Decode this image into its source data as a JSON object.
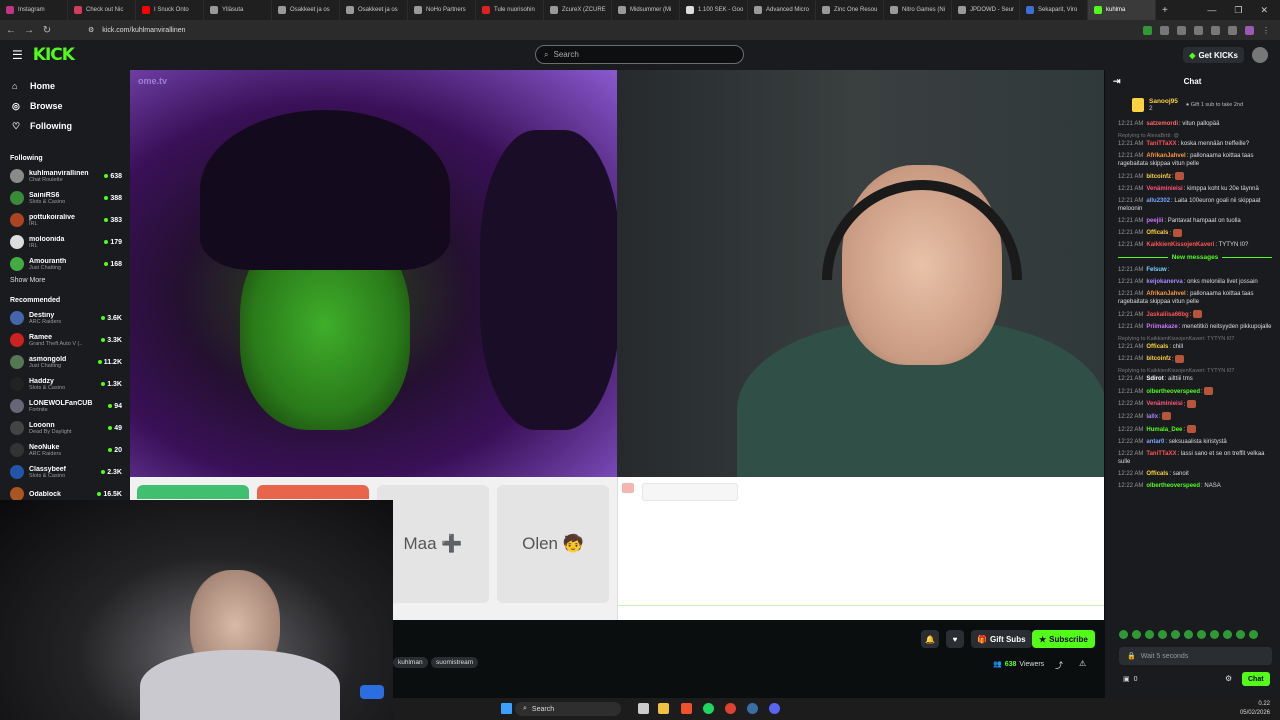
{
  "browser": {
    "tabs": [
      {
        "label": "Instagram",
        "color": "#c13584"
      },
      {
        "label": "Check out Nic",
        "color": "#d23c5a"
      },
      {
        "label": "I Snuck Onto",
        "color": "#ff0000"
      },
      {
        "label": "Ylläsuta",
        "color": "#9a9a9a"
      },
      {
        "label": "Osakkeet ja os",
        "color": "#9a9a9a"
      },
      {
        "label": "Osakkeet ja os",
        "color": "#9a9a9a"
      },
      {
        "label": "NoHo Partners",
        "color": "#9a9a9a"
      },
      {
        "label": "Tule nuorisohin",
        "color": "#e02020"
      },
      {
        "label": "ZcureX (ZCURE",
        "color": "#9a9a9a"
      },
      {
        "label": "Midsummer (Mi",
        "color": "#9a9a9a"
      },
      {
        "label": "1.100 SEK - Goo",
        "color": "#dddddd"
      },
      {
        "label": "Advanced Micro",
        "color": "#9a9a9a"
      },
      {
        "label": "Zinc One Resou",
        "color": "#9a9a9a"
      },
      {
        "label": "Nitro Games (Ni",
        "color": "#9a9a9a"
      },
      {
        "label": "JPDOWD - Seur",
        "color": "#9a9a9a"
      },
      {
        "label": "Sekaparit, Viro",
        "color": "#3b6fd4"
      },
      {
        "label": "kuhlma",
        "color": "#53fc18",
        "active": true
      }
    ],
    "new_tab": "+",
    "url": "kick.com/kuhlmanvirallinen"
  },
  "header": {
    "logo": "KICK",
    "search_placeholder": "Search",
    "get_kicks": "Get KICKs"
  },
  "sidebar": {
    "nav": [
      {
        "label": "Home",
        "icon": "home-icon",
        "glyph": "⌂"
      },
      {
        "label": "Browse",
        "icon": "browse-icon",
        "glyph": "◎"
      },
      {
        "label": "Following",
        "icon": "heart-icon",
        "glyph": "♡"
      }
    ],
    "following_title": "Following",
    "following": [
      {
        "name": "kuhlmanvirallinen",
        "category": "Chat Roulette",
        "viewers": "638",
        "color": "#8a8a8a"
      },
      {
        "name": "SainiRS6",
        "category": "Slots & Casino",
        "viewers": "388",
        "color": "#3a8a3a"
      },
      {
        "name": "pottukoiralive",
        "category": "IRL",
        "viewers": "383",
        "color": "#aa4422"
      },
      {
        "name": "moloonida",
        "category": "IRL",
        "viewers": "179",
        "color": "#ddd"
      },
      {
        "name": "Amouranth",
        "category": "Just Chatting",
        "viewers": "168",
        "color": "#44aa44"
      }
    ],
    "show_more": "Show More",
    "recommended_title": "Recommended",
    "recommended": [
      {
        "name": "Destiny",
        "category": "ARC Raiders",
        "viewers": "3.6K",
        "color": "#4466aa"
      },
      {
        "name": "Ramee",
        "category": "Grand Theft Auto V (..",
        "viewers": "3.3K",
        "color": "#cc2222"
      },
      {
        "name": "asmongold",
        "category": "Just Chatting",
        "viewers": "11.2K",
        "color": "#557755"
      },
      {
        "name": "Haddzy",
        "category": "Slots & Casino",
        "viewers": "1.3K",
        "color": "#222"
      },
      {
        "name": "LONEWOLFanCUB",
        "category": "Fortnite",
        "viewers": "94",
        "color": "#667"
      },
      {
        "name": "Looonn",
        "category": "Dead By Daylight",
        "viewers": "49",
        "color": "#444"
      },
      {
        "name": "NeoNuke",
        "category": "ARC Raiders",
        "viewers": "20",
        "color": "#333"
      },
      {
        "name": "Classybeef",
        "category": "Slots & Casino",
        "viewers": "2.3K",
        "color": "#2255aa"
      },
      {
        "name": "Odablock",
        "category": "",
        "viewers": "16.5K",
        "color": "#aa5522"
      }
    ]
  },
  "stream": {
    "ome_logo": "ome.tv",
    "cards": [
      "Maa ➕",
      "Olen 🧒"
    ],
    "gift_subs": "Gift Subs",
    "subscribe": "Subscribe",
    "viewers": "638",
    "viewers_label": "Viewers",
    "tags": [
      "kuhlman",
      "suomistream"
    ]
  },
  "chat": {
    "title": "Chat",
    "pinned_user": "Sanooj95",
    "pinned_text": "Gift 1 sub to take 2nd",
    "pinned_count": "2",
    "messages_before": [
      {
        "time": "12:21 AM",
        "user": "satzemordi",
        "color": "#ff6666",
        "text": "vitun pallopää"
      },
      {
        "time": "12:21 AM",
        "reply": "Replying to AlexaBrtti: @",
        "user": "TaniTTaXX",
        "color": "#ff5555",
        "text": "koska mennään treffeille?"
      },
      {
        "time": "12:21 AM",
        "user": "AfrikanJahvel",
        "color": "#ff9933",
        "text": "pallonaama koittaa taas ragebaitata skippaa vitun pelle"
      },
      {
        "time": "12:21 AM",
        "user": "bitcoinfz",
        "color": "#ffd23f",
        "text": "",
        "emote": true
      },
      {
        "time": "12:21 AM",
        "user": "Venäminieisi",
        "color": "#ff5577",
        "text": "kimppa koht ku 20e täynnä"
      },
      {
        "time": "12:21 AM",
        "user": "allu2302",
        "color": "#7aa5ff",
        "text": "Laita 100euron goali nii skippaat meloonin"
      },
      {
        "time": "12:21 AM",
        "user": "peejiii",
        "color": "#cc77ff",
        "text": "Pantavat hampaat on tuolla"
      },
      {
        "time": "12:21 AM",
        "user": "Officals",
        "color": "#ffd23f",
        "text": "",
        "emote": true
      },
      {
        "time": "12:21 AM",
        "user": "KaikkienKissojenKaveri",
        "color": "#ff5555",
        "text": "TYTYN I0?"
      }
    ],
    "new_messages": "New messages",
    "messages_after": [
      {
        "time": "12:21 AM",
        "user": "Felsuw",
        "color": "#7ad3ff",
        "text": ""
      },
      {
        "time": "12:21 AM",
        "user": "keijokanerva",
        "color": "#aa88ff",
        "text": "onks meloniila livet jossain"
      },
      {
        "time": "12:21 AM",
        "user": "AfrikanJahvel",
        "color": "#ff9933",
        "text": "pallonaama koittaa taas ragebaitata skippaa vitun pelle"
      },
      {
        "time": "12:21 AM",
        "user": "Jaskaliisa66bg",
        "color": "#ff5555",
        "text": "",
        "emote": true
      },
      {
        "time": "12:21 AM",
        "user": "Priimakaze",
        "color": "#cc77ff",
        "text": "menetitkö neitsyyden pikkupojalle"
      },
      {
        "time": "12:21 AM",
        "reply": "Replying to KaikkienKissojenKaveri: TYTYN I0?",
        "user": "Officals",
        "color": "#ffd23f",
        "text": "chill"
      },
      {
        "time": "12:21 AM",
        "user": "bitcoinfz",
        "color": "#ffd23f",
        "text": "",
        "emote": true
      },
      {
        "time": "12:21 AM",
        "reply": "Replying to KaikkienKissojenKaveri: TYTYN I0?",
        "user": "Sdirot",
        "color": "#ffffff",
        "text": "ailttiii tms"
      },
      {
        "time": "12:21 AM",
        "user": "olbertheoverspeed",
        "color": "#53fc18",
        "text": "",
        "emote": true
      },
      {
        "time": "12:22 AM",
        "user": "Venäminieisi",
        "color": "#ff5577",
        "text": "",
        "emote": true
      },
      {
        "time": "12:22 AM",
        "user": "lallx",
        "color": "#aa88ff",
        "text": "",
        "emote": true
      },
      {
        "time": "12:22 AM",
        "user": "Humala_Dee",
        "color": "#53fc18",
        "text": "",
        "emote": true
      },
      {
        "time": "12:22 AM",
        "user": "antar0",
        "color": "#7aa5ff",
        "text": "seksuaalista kiristystä"
      },
      {
        "time": "12:22 AM",
        "user": "TaniTTaXX",
        "color": "#ff5555",
        "text": "lassi sano et se on treffit velkaa sulle"
      },
      {
        "time": "12:22 AM",
        "user": "Officals",
        "color": "#ffd23f",
        "text": "sanoit"
      },
      {
        "time": "12:22 AM",
        "user": "olbertheoverspeed",
        "color": "#53fc18",
        "text": "NASA"
      }
    ],
    "input_placeholder": "Wait 5 seconds",
    "kicks": "0",
    "send": "Chat"
  },
  "taskbar": {
    "search": "Search",
    "time": "0.22",
    "date": "05/02/2026"
  }
}
